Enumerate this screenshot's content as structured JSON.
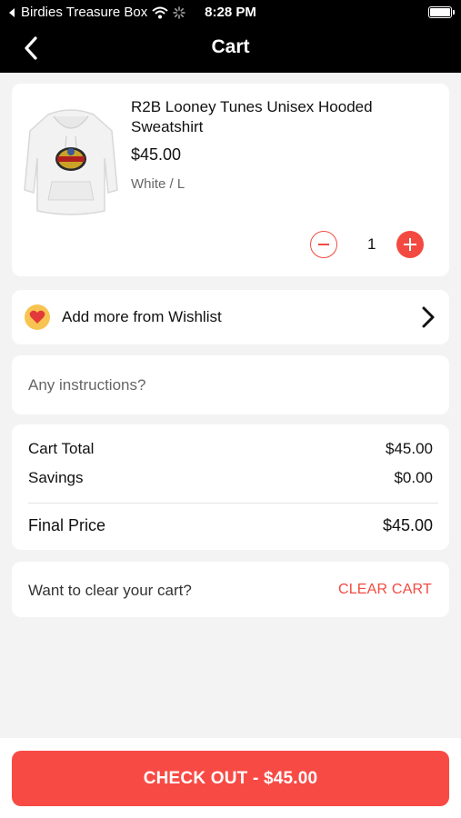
{
  "status_bar": {
    "carrier": "Birdies Treasure Box",
    "time": "8:28 PM"
  },
  "nav": {
    "title": "Cart",
    "back_icon": "chevron-left-icon"
  },
  "cart_item": {
    "name": "R2B Looney Tunes Unisex Hooded Sweatshirt",
    "price": "$45.00",
    "variant": "White / L",
    "quantity": "1"
  },
  "wishlist": {
    "label": "Add more from Wishlist",
    "icon": "heart-icon"
  },
  "instructions": {
    "placeholder": "Any instructions?",
    "value": ""
  },
  "totals": {
    "cart_total_label": "Cart Total",
    "cart_total_value": "$45.00",
    "savings_label": "Savings",
    "savings_value": "$0.00",
    "final_label": "Final Price",
    "final_value": "$45.00"
  },
  "clear_cart": {
    "prompt": "Want to clear your cart?",
    "action": "CLEAR CART"
  },
  "checkout": {
    "label": "CHECK OUT - $45.00"
  },
  "colors": {
    "accent": "#f24a41",
    "checkout_bg": "#f84a44",
    "header_bg": "#000000",
    "page_bg": "#f3f3f3"
  }
}
